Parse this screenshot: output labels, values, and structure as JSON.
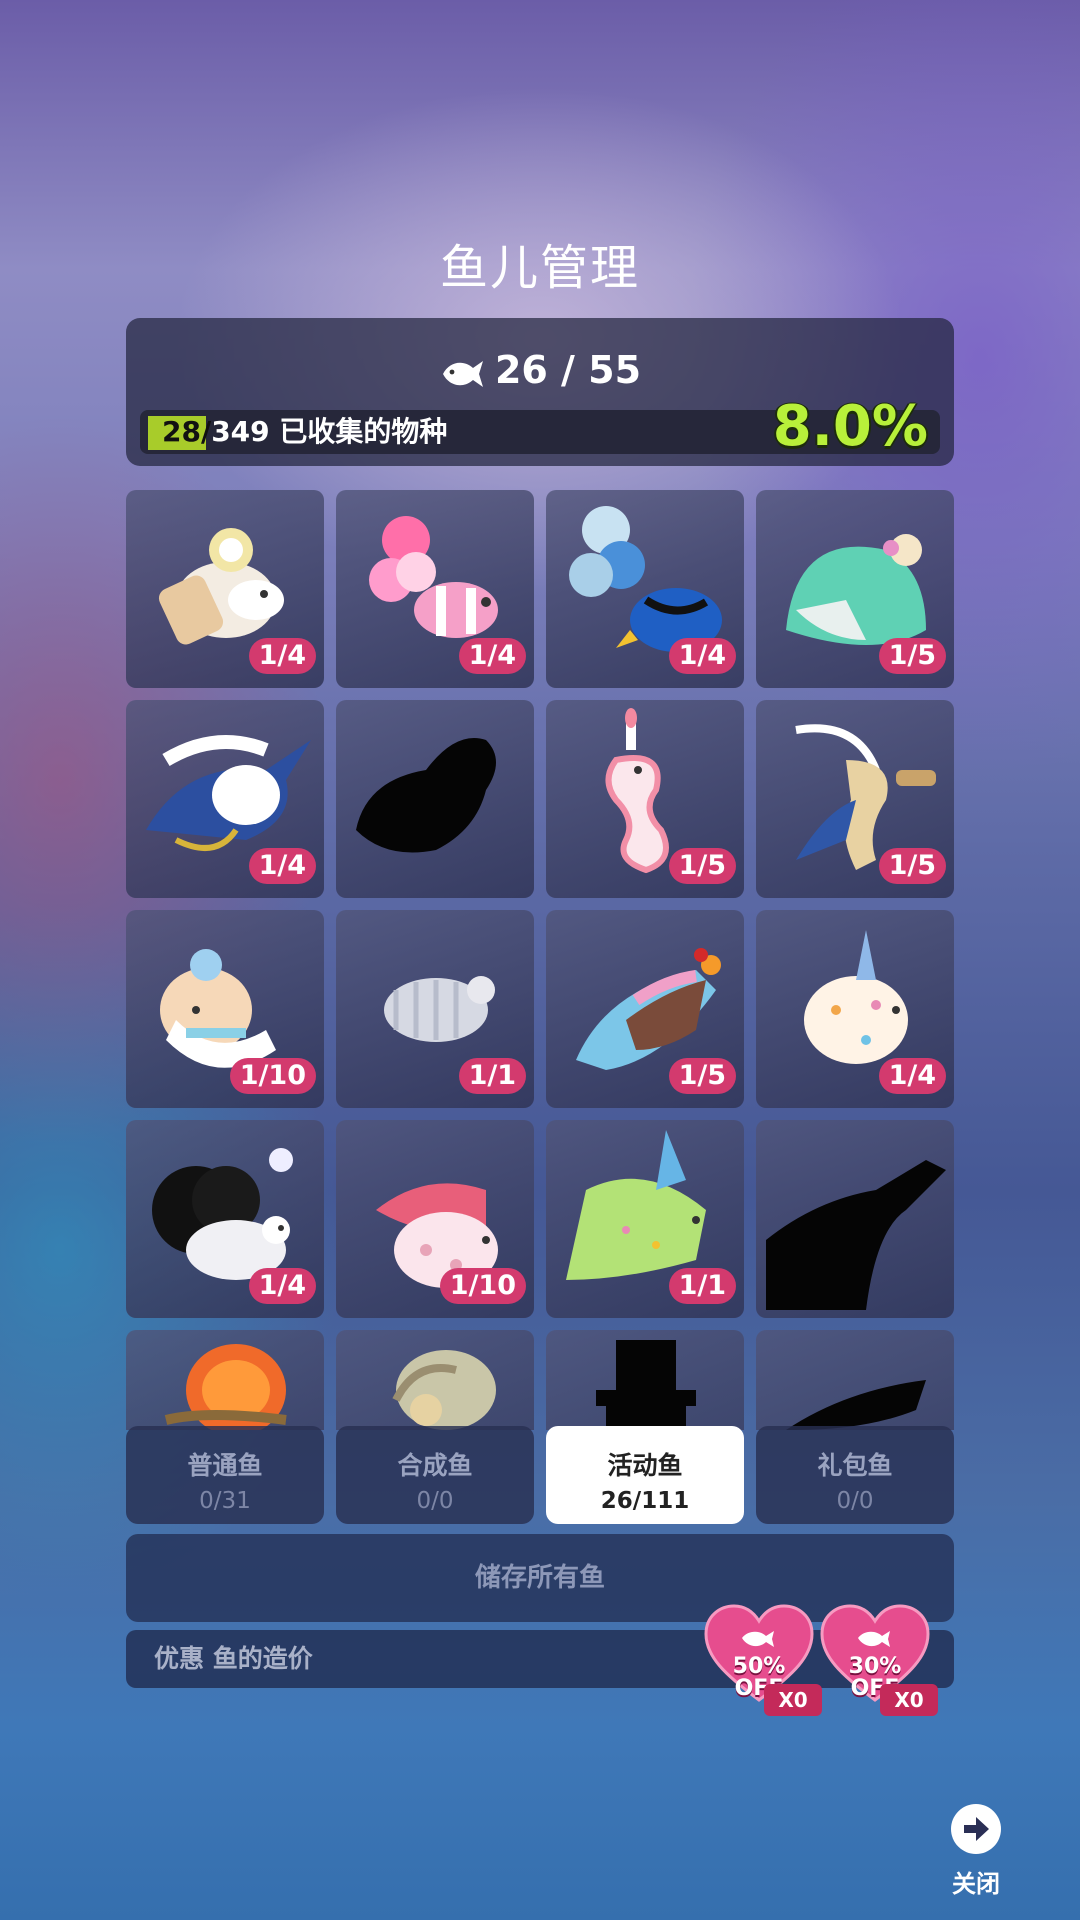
{
  "header": {
    "title": "鱼儿管理"
  },
  "stats": {
    "fish_count": "26 / 55",
    "collected_count": "28/",
    "collected_rest": "349 已收集的物种",
    "collected_fraction": 0.08,
    "percent": "8.0%",
    "fish_icon": "fish-icon"
  },
  "cards": [
    {
      "name": "cake-fish",
      "badge": "1/4",
      "silhouette": false
    },
    {
      "name": "balloon-clownfish",
      "badge": "1/4",
      "silhouette": false
    },
    {
      "name": "balloon-tang",
      "badge": "1/4",
      "silhouette": false
    },
    {
      "name": "mint-dress-fish",
      "badge": "1/5",
      "silhouette": false
    },
    {
      "name": "swordfish-captain",
      "badge": "1/4",
      "silhouette": false
    },
    {
      "name": "unknown-turtle",
      "badge": "",
      "silhouette": true
    },
    {
      "name": "candle-seahorse",
      "badge": "1/5",
      "silhouette": false
    },
    {
      "name": "feather-seahorse",
      "badge": "1/5",
      "silhouette": false
    },
    {
      "name": "lamb-fish",
      "badge": "1/10",
      "silhouette": false
    },
    {
      "name": "isopod",
      "badge": "1/1",
      "silhouette": false
    },
    {
      "name": "parfait-squid",
      "badge": "1/5",
      "silhouette": false
    },
    {
      "name": "party-puffer",
      "badge": "1/4",
      "silhouette": false
    },
    {
      "name": "sheep-fish",
      "badge": "1/4",
      "silhouette": false
    },
    {
      "name": "strawberry-fish",
      "badge": "1/10",
      "silhouette": false
    },
    {
      "name": "party-hat-fish",
      "badge": "1/1",
      "silhouette": false
    },
    {
      "name": "unknown-crocodile",
      "badge": "",
      "silhouette": true
    },
    {
      "name": "orange-jelly-snail",
      "badge": "",
      "silhouette": false
    },
    {
      "name": "snail-elephant",
      "badge": "",
      "silhouette": false
    },
    {
      "name": "top-hat-silhouette",
      "badge": "",
      "silhouette": true
    },
    {
      "name": "shark-silhouette",
      "badge": "",
      "silhouette": true
    }
  ],
  "tabs": [
    {
      "label": "普通鱼",
      "count": "0/31"
    },
    {
      "label": "合成鱼",
      "count": "0/0"
    },
    {
      "label": "活动鱼",
      "count": "26/111"
    },
    {
      "label": "礼包鱼",
      "count": "0/0"
    }
  ],
  "store_button": "储存所有鱼",
  "discount": {
    "label": "优惠 鱼的造价",
    "coupons": [
      {
        "line1": "50%",
        "line2": "OFF",
        "qty": "X0"
      },
      {
        "line1": "30%",
        "line2": "OFF",
        "qty": "X0"
      }
    ]
  },
  "close": {
    "label": "关闭",
    "icon": "arrow-right-icon"
  },
  "colors": {
    "accent_green": "#b8f03a",
    "badge_pink": "#d33a6e",
    "active_tab": "#ffffff"
  }
}
